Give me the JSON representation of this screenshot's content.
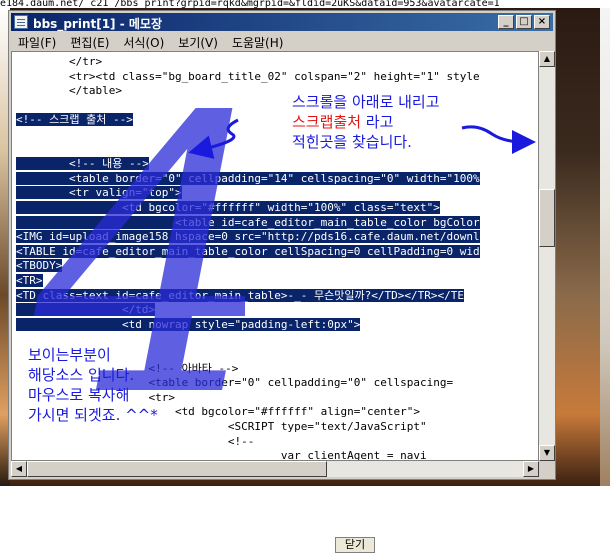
{
  "browser": {
    "address_text": "e184.daum.net/_c21_/bbs_print?grpid=rqkd&mgrpid=&fldid=2uKS&dataid=953&avatarcate=1",
    "close_button_label": "닫기"
  },
  "window": {
    "title": "bbs_print[1] - 메모장",
    "minimize_label": "_",
    "maximize_label": "□",
    "close_label": "×"
  },
  "menu": {
    "items": [
      "파일(F)",
      "편집(E)",
      "서식(O)",
      "보기(V)",
      "도움말(H)"
    ]
  },
  "code_lines": [
    "        </tr>",
    "        <tr><td class=\"bg_board_title_02\" colspan=\"2\" height=\"1\" style",
    "        </table>",
    "",
    "<!-- 스크랩 출처 -->",
    "",
    "",
    "        <!-- 내용 -->",
    "        <table border=\"0\" cellpadding=\"14\" cellspacing=\"0\" width=\"100%",
    "        <tr valign=\"top\">",
    "                <td bgcolor=\"#ffffff\" width=\"100%\" class=\"text\">",
    "                        <table id=cafe_editor_main_table_color bgColor",
    "<IMG id=upload_image158 hspace=0 src=\"http://pds16.cafe.daum.net/downl",
    "<TABLE id=cafe_editor_main_table_color cellSpacing=0 cellPadding=0 wid",
    "<TBODY>",
    "<TR>",
    "<TD class=text id=cafe_editor_main_table>-_- 무슨맛일까?</TD></TR></TE",
    "                </td>",
    "                <td nowrap style=\"padding-left:0px\">",
    "",
    "",
    "                    <!-- 아바타 -->",
    "                    <table border=\"0\" cellpadding=\"0\" cellspacing=",
    "                    <tr>",
    "                        <td bgcolor=\"#ffffff\" align=\"center\">",
    "                                <SCRIPT type=\"text/JavaScript\"",
    "                                <!--",
    "                                        var clientAgent = navi"
  ],
  "annotations": {
    "big_number": "4",
    "note_top_line1": "스크롤을 아래로 내리고",
    "note_top_line2": "스크랩출처",
    "note_top_line2_rest": " 라고",
    "note_top_line3": "적힌곳을 찾습니다.",
    "note_bottom": [
      "보이는부분이",
      "해당소스 입니다.",
      "마우스로 복사해",
      "가시면 되겟죠. ^^*"
    ]
  },
  "colors": {
    "selection": "#0a246a",
    "annotation_blue": "#1a1adf",
    "annotation_red": "#e01818",
    "title_gradient_start": "#0a246a"
  }
}
